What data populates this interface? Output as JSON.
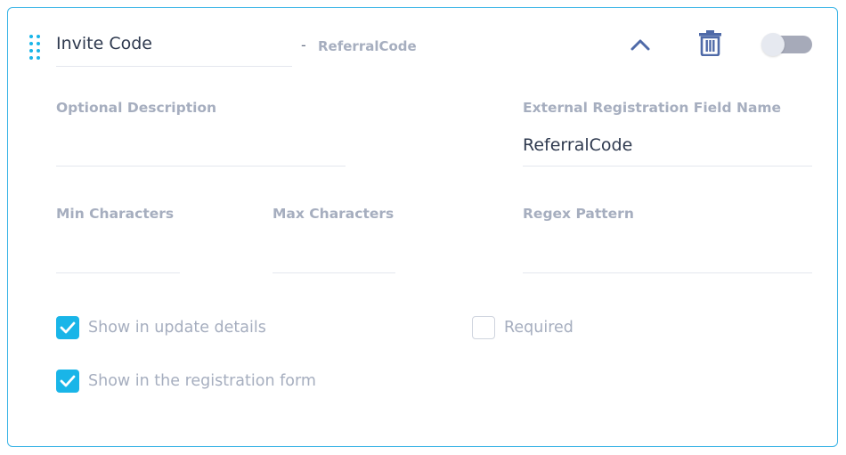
{
  "field": {
    "title_value": "Invite Code",
    "separator": "-",
    "key": "ReferralCode",
    "enabled": false
  },
  "icons": {
    "drag": "drag-handle-icon",
    "collapse": "chevron-up-icon",
    "delete": "trash-icon"
  },
  "form": {
    "optional_description": {
      "label": "Optional Description",
      "value": ""
    },
    "external_field_name": {
      "label": "External Registration Field Name",
      "value": "ReferralCode"
    },
    "min_characters": {
      "label": "Min Characters",
      "value": ""
    },
    "max_characters": {
      "label": "Max Characters",
      "value": ""
    },
    "regex_pattern": {
      "label": "Regex Pattern",
      "value": ""
    }
  },
  "options": {
    "show_update_details": {
      "label": "Show in update details",
      "checked": true
    },
    "required": {
      "label": "Required",
      "checked": false
    },
    "show_registration_form": {
      "label": "Show in the registration form",
      "checked": true
    }
  },
  "colors": {
    "accent": "#19b5e8",
    "border": "#3ab4e6",
    "icon": "#4f6aa8",
    "muted_text": "#a6aebf"
  }
}
